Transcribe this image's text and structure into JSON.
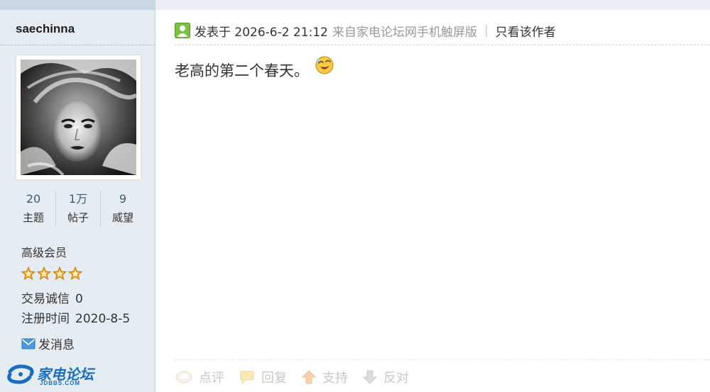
{
  "author": {
    "name": "saechinna",
    "stats": [
      {
        "value": "20",
        "label": "主题"
      },
      {
        "value": "1万",
        "label": "帖子"
      },
      {
        "value": "9",
        "label": "威望"
      }
    ],
    "level": "高级会员",
    "stars": 4,
    "trade_label": "交易诚信",
    "trade_value": "0",
    "reg_label": "注册时间",
    "reg_value": "2020-8-5",
    "send_message": "发消息"
  },
  "post": {
    "posted_at": "发表于 2026-6-2 21:12",
    "source": "来自家电论坛网手机触屏版",
    "separator": "|",
    "only_author": "只看该作者",
    "body": "老高的第二个春天。",
    "emoji_icon": "grin-emoji-icon"
  },
  "actions": [
    {
      "label": "点评",
      "icon": "comment-icon"
    },
    {
      "label": "回复",
      "icon": "reply-icon"
    },
    {
      "label": "支持",
      "icon": "thumb-up-arrow-icon"
    },
    {
      "label": "反对",
      "icon": "thumb-down-arrow-icon"
    }
  ],
  "logo": {
    "text": "家电论坛",
    "sub": "JDBBS.COM"
  },
  "colors": {
    "sidebar_bg": "#e5edf2",
    "link_blue": "#3c5a73",
    "star_gold": "#f5a623"
  }
}
